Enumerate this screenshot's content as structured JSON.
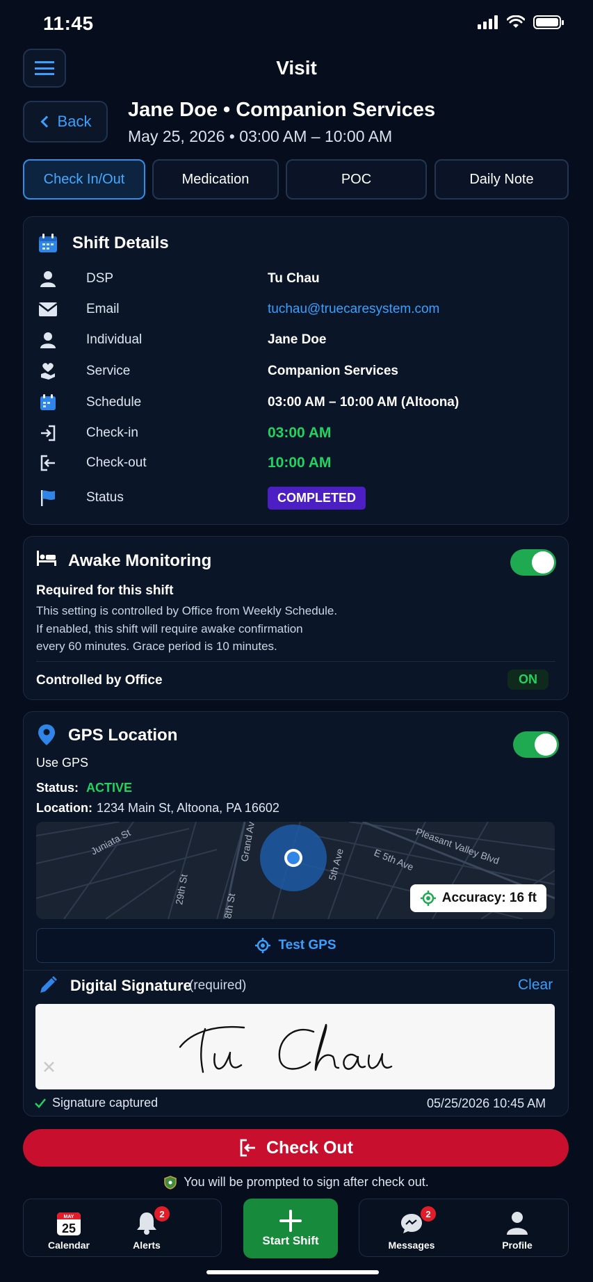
{
  "status_bar": {
    "time": "11:45"
  },
  "header": {
    "title": "Visit",
    "back_label": "Back"
  },
  "visit": {
    "title": "Jane Doe • Companion Services",
    "subtitle": "May 25, 2026 • 03:00 AM – 10:00 AM"
  },
  "tabs": [
    {
      "label": "Check In/Out",
      "active": true
    },
    {
      "label": "Medication"
    },
    {
      "label": "POC"
    },
    {
      "label": "Daily Note"
    }
  ],
  "shift_details": {
    "title": "Shift Details",
    "rows": [
      {
        "icon": "person-icon",
        "label": "DSP",
        "value": "Tu Chau"
      },
      {
        "icon": "mail-icon",
        "label": "Email",
        "value": "tuchau@truecaresystem.com"
      },
      {
        "icon": "person-icon",
        "label": "Individual",
        "value": "Jane Doe"
      },
      {
        "icon": "heart-hand-icon",
        "label": "Service",
        "value": "Companion Services"
      },
      {
        "icon": "calendar-icon",
        "label": "Schedule",
        "value": "03:00 AM – 10:00 AM (Altoona)"
      },
      {
        "icon": "check-in-icon",
        "label": "Check-in",
        "value": "03:00 AM"
      },
      {
        "icon": "check-out-icon",
        "label": "Check-out",
        "value": "10:00 AM"
      },
      {
        "icon": "flag-icon",
        "label": "Status",
        "value": "COMPLETED"
      }
    ]
  },
  "awake_monitoring": {
    "title": "Awake Monitoring",
    "enabled": true,
    "required_label": "Required for this shift",
    "description_lines": [
      "This setting is controlled by Office from Weekly Schedule.",
      "If enabled, this shift will require awake confirmation",
      "every 60 minutes. Grace period is 10 minutes."
    ],
    "controlled_label": "Controlled by Office",
    "controlled_value": "ON"
  },
  "gps": {
    "title": "GPS Location",
    "enabled": true,
    "use_label": "Use GPS",
    "status_label": "Status:",
    "status_value": "ACTIVE",
    "location_label": "Location:",
    "location_value": "1234 Main St, Altoona, PA 16602",
    "map_streets": [
      "Juniata St",
      "29th St",
      "Pleasant Valley Blvd",
      "E 5th Ave",
      "5th Ave",
      "Grand Ave",
      "8th St"
    ],
    "accuracy_label": "Accuracy: 16 ft",
    "test_button": "Test GPS"
  },
  "signature": {
    "title": "Digital Signature",
    "required_note": "(required)",
    "clear_label": "Clear",
    "signed_name": "Tu Chau",
    "captured_label": "Signature captured",
    "timestamp": "05/25/2026 10:45 AM"
  },
  "checkout": {
    "button_label": "Check Out",
    "note": "You will be prompted to sign after check out."
  },
  "bottom_nav": {
    "calendar": {
      "label": "Calendar",
      "day": "25",
      "month": "MAY"
    },
    "alerts": {
      "label": "Alerts",
      "badge": "2"
    },
    "start_shift": {
      "label": "Start Shift"
    },
    "messages": {
      "label": "Messages",
      "badge": "2"
    },
    "profile": {
      "label": "Profile"
    }
  },
  "colors": {
    "background": "#060d1c",
    "accent": "#3aa0ff",
    "success": "#22d35f",
    "danger": "#c8102e",
    "status_badge": "#4c1fc4"
  }
}
